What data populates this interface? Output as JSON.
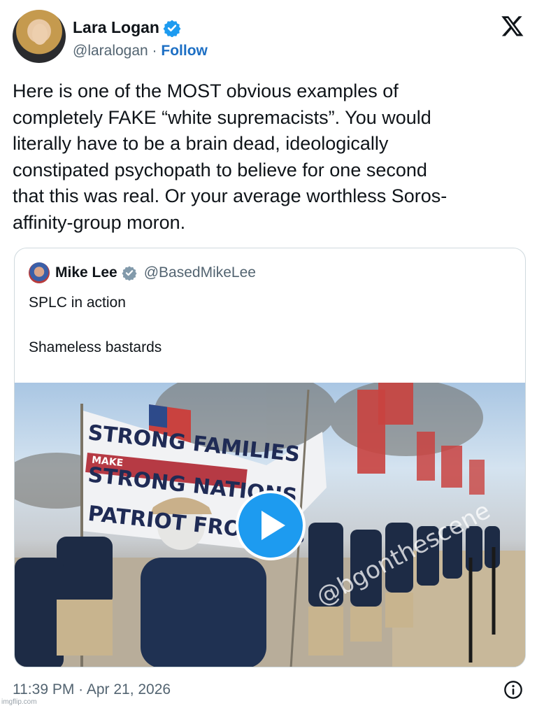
{
  "author": {
    "display_name": "Lara Logan",
    "handle": "@laralogan",
    "separator": " · ",
    "follow_label": "Follow"
  },
  "brand_icon": "x-logo-icon",
  "tweet": {
    "text": "Here is one of the MOST obvious examples of\ncompletely FAKE “white supremacists”. You would\nliterally have to be a brain dead, ideologically\nconstipated psychopath to believe for one second\nthat this was real. Or your average worthless Soros-\naffinity-group moron.",
    "timestamp": "11:39 PM · Apr 21, 2026"
  },
  "quoted": {
    "display_name": "Mike Lee",
    "handle": "@BasedMikeLee",
    "text": "SPLC in action\n\nShameless bastards",
    "media": {
      "type": "video",
      "banner_line1": "STRONG FAMILIES",
      "banner_make": "MAKE",
      "banner_line2": "STRONG NATIONS",
      "banner_line3": "PATRIOT FRONT.us",
      "watermark": "@bgonthescene"
    }
  },
  "footer": {
    "credit": "imgflip.com"
  },
  "colors": {
    "verified": "#1d9bf0",
    "follow": "#1d6fc4",
    "play": "#1d9bf0",
    "text": "#0f1419",
    "muted": "#536471"
  }
}
